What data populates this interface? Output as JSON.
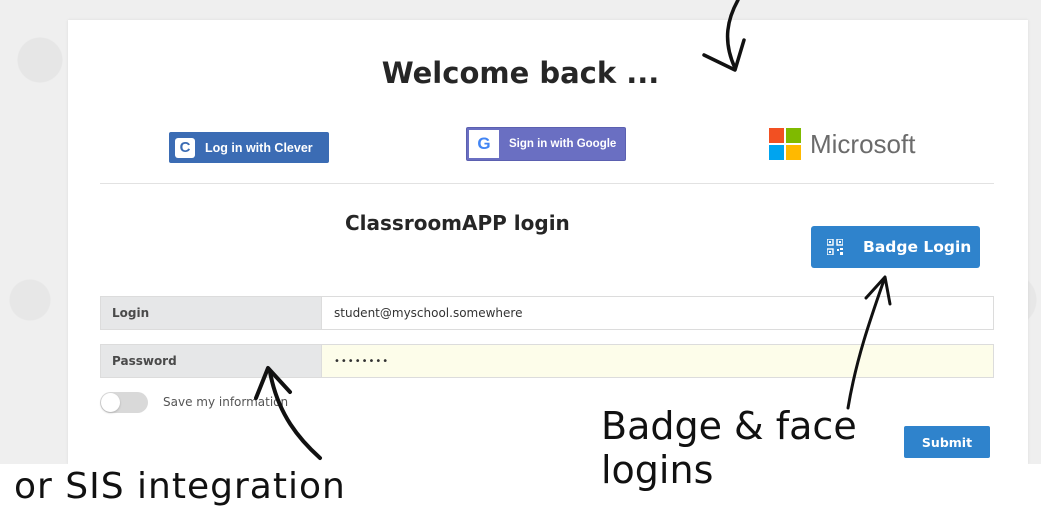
{
  "welcome_title": "Welcome back ...",
  "sso": {
    "clever_label": "Log in with Clever",
    "clever_icon_glyph": "C",
    "google_label": "Sign in with Google",
    "google_icon_glyph": "G",
    "microsoft_label": "Microsoft"
  },
  "login": {
    "title": "ClassroomAPP login",
    "badge_button_label": "Badge Login",
    "login_label": "Login",
    "login_value": "student@myschool.somewhere",
    "password_label": "Password",
    "password_value": "password",
    "save_info_label": "Save my information",
    "save_info_enabled": false,
    "submit_label": "Submit"
  },
  "annotations": {
    "sis": "or SIS integration",
    "badge_line1": "Badge & face",
    "badge_line2": "logins"
  },
  "colors": {
    "primary_blue": "#2f83cc",
    "clever_blue": "#3b6cb4",
    "google_purple": "#6a6fc2",
    "ms_red": "#f25022",
    "ms_green": "#7fba00",
    "ms_blue": "#00a4ef",
    "ms_yellow": "#ffb900"
  }
}
